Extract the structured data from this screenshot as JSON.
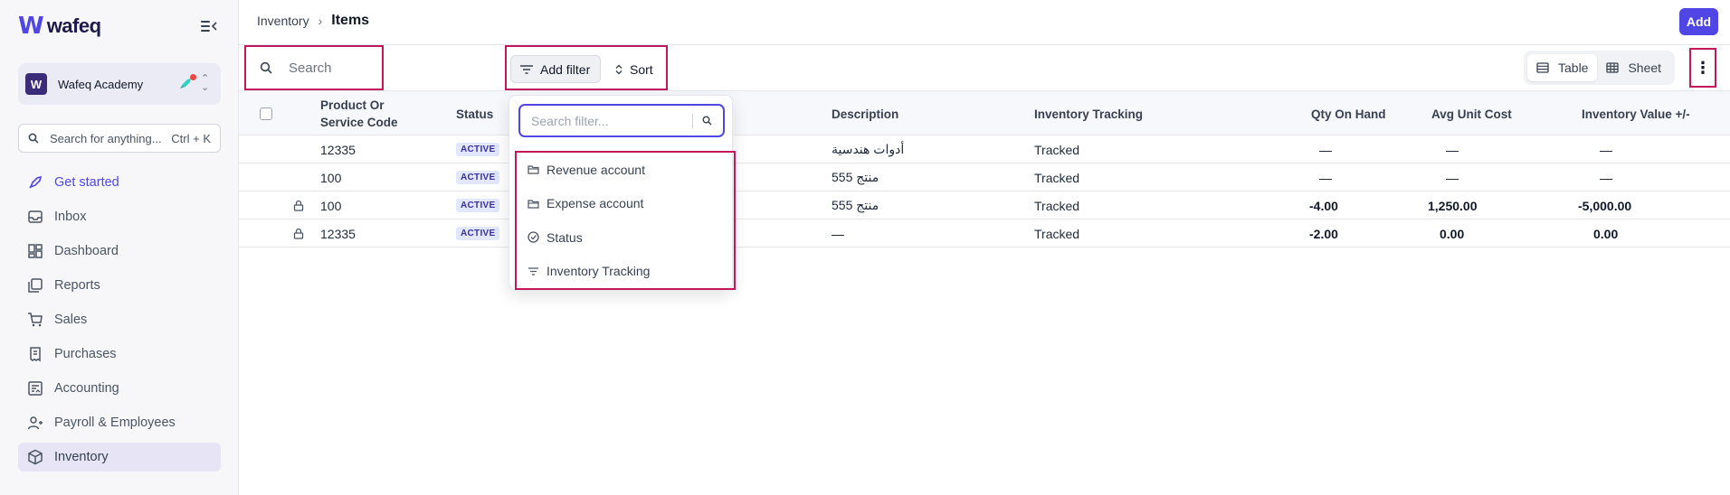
{
  "brand": {
    "name": "wafeq"
  },
  "org": {
    "name": "Wafeq Academy",
    "initial": "W"
  },
  "sidebar_search": {
    "placeholder": "Search for anything...",
    "shortcut": "Ctrl + K"
  },
  "nav": [
    {
      "label": "Get started",
      "icon": "rocket-icon"
    },
    {
      "label": "Inbox",
      "icon": "inbox-icon"
    },
    {
      "label": "Dashboard",
      "icon": "dashboard-icon"
    },
    {
      "label": "Reports",
      "icon": "reports-icon"
    },
    {
      "label": "Sales",
      "icon": "cart-icon"
    },
    {
      "label": "Purchases",
      "icon": "receipt-icon"
    },
    {
      "label": "Accounting",
      "icon": "ledger-icon"
    },
    {
      "label": "Payroll & Employees",
      "icon": "users-icon"
    },
    {
      "label": "Inventory",
      "icon": "box-icon"
    }
  ],
  "breadcrumb": {
    "parent": "Inventory",
    "separator": "›",
    "current": "Items"
  },
  "header": {
    "add_label": "Add"
  },
  "toolbar": {
    "search_placeholder": "Search",
    "add_filter_label": "Add filter",
    "sort_label": "Sort",
    "view_table_label": "Table",
    "view_sheet_label": "Sheet",
    "more_label": "⋮"
  },
  "columns": {
    "code": "Product Or Service Code",
    "status": "Status",
    "description": "Description",
    "tracking": "Inventory Tracking",
    "qty": "Qty On Hand",
    "avg_cost": "Avg Unit Cost",
    "value": "Inventory Value +/-"
  },
  "rows": [
    {
      "locked": false,
      "code": "12335",
      "status": "ACTIVE",
      "description": "أدوات هندسية",
      "tracking": "Tracked",
      "qty": "—",
      "avg_cost": "—",
      "value": "—"
    },
    {
      "locked": false,
      "code": "100",
      "status": "ACTIVE",
      "description": "منتج 555",
      "tracking": "Tracked",
      "qty": "—",
      "avg_cost": "—",
      "value": "—"
    },
    {
      "locked": true,
      "code": "100",
      "status": "ACTIVE",
      "description": "منتج 555",
      "tracking": "Tracked",
      "qty": "-4.00",
      "avg_cost": "1,250.00",
      "value": "-5,000.00"
    },
    {
      "locked": true,
      "code": "12335",
      "status": "ACTIVE",
      "description": "—",
      "tracking": "Tracked",
      "qty": "-2.00",
      "avg_cost": "0.00",
      "value": "0.00"
    }
  ],
  "filter_dropdown": {
    "placeholder": "Search filter...",
    "items": [
      {
        "label": "Revenue account",
        "icon": "folder-icon"
      },
      {
        "label": "Expense account",
        "icon": "folder-icon"
      },
      {
        "label": "Status",
        "icon": "check-circle-icon"
      },
      {
        "label": "Inventory Tracking",
        "icon": "filter-icon"
      }
    ]
  },
  "colors": {
    "accent": "#4f46e5",
    "highlight": "#c2185b",
    "badge_bg": "#e0e7ff"
  }
}
